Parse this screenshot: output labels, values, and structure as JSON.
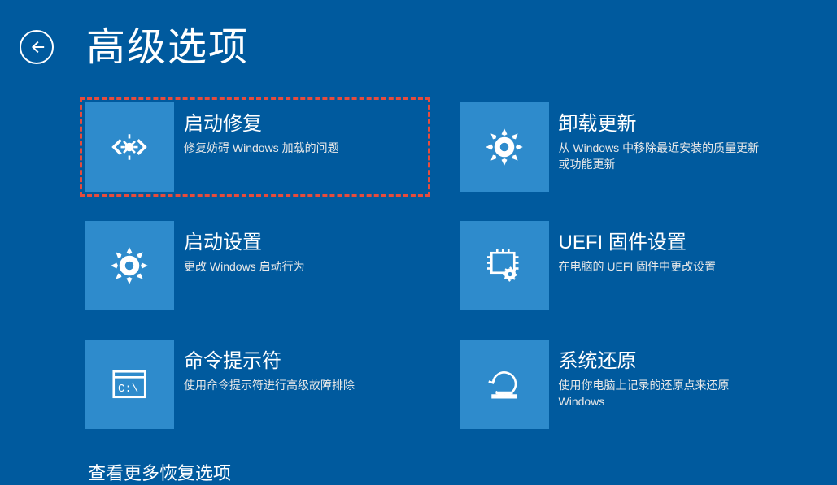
{
  "page_title": "高级选项",
  "more_options_label": "查看更多恢复选项",
  "options": [
    {
      "title": "启动修复",
      "desc": "修复妨碍 Windows 加载的问题",
      "icon": "wrench-code",
      "highlighted": true
    },
    {
      "title": "卸载更新",
      "desc": "从 Windows 中移除最近安装的质量更新或功能更新",
      "icon": "gear",
      "highlighted": false
    },
    {
      "title": "启动设置",
      "desc": "更改 Windows 启动行为",
      "icon": "gear",
      "highlighted": false
    },
    {
      "title": "UEFI 固件设置",
      "desc": "在电脑的 UEFI 固件中更改设置",
      "icon": "chip-gear",
      "highlighted": false
    },
    {
      "title": "命令提示符",
      "desc": "使用命令提示符进行高级故障排除",
      "icon": "terminal",
      "highlighted": false
    },
    {
      "title": "系统还原",
      "desc": "使用你电脑上记录的还原点来还原 Windows",
      "icon": "restore",
      "highlighted": false
    }
  ]
}
